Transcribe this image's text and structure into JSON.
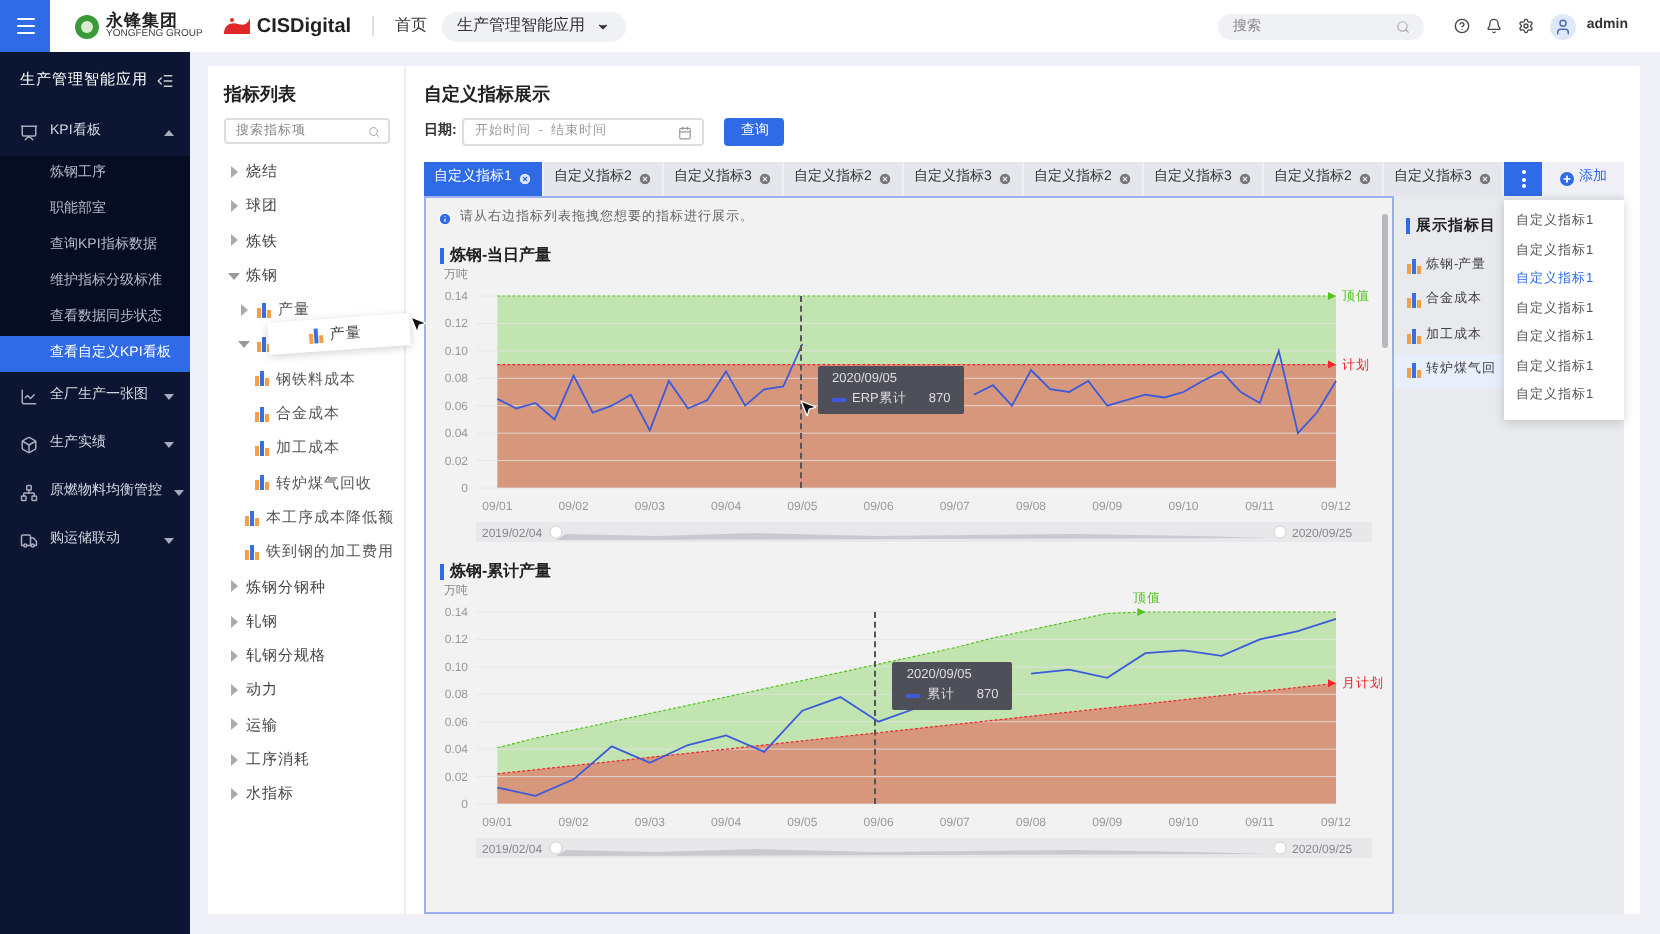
{
  "topbar": {
    "logos": [
      {
        "kind": "yongfeng",
        "name": "永锋集团",
        "subtitle": "YONGFENG GROUP"
      },
      {
        "kind": "cis",
        "name": "CISDigital"
      }
    ],
    "nav": [
      {
        "kind": "link",
        "label": "首页"
      },
      {
        "kind": "dropdown",
        "label": "生产管理智能应用"
      }
    ],
    "search": {
      "placeholder": "搜索"
    },
    "user": "admin"
  },
  "sidebar": {
    "title": "生产管理智能应用",
    "items": [
      {
        "label": "KPI看板",
        "expanded": true,
        "children": [
          {
            "label": "炼钢工序",
            "selected": false
          },
          {
            "label": "职能部室",
            "selected": false
          },
          {
            "label": "查询KPI指标数据",
            "selected": false
          },
          {
            "label": "维护指标分级标准",
            "selected": false
          },
          {
            "label": "查看数据同步状态",
            "selected": false
          },
          {
            "label": "查看自定义KPI看板",
            "selected": true
          }
        ]
      },
      {
        "label": "全厂生产一张图",
        "expanded": false
      },
      {
        "label": "生产实绩",
        "expanded": false
      },
      {
        "label": "原燃物料均衡管控",
        "expanded": false
      },
      {
        "label": "购运储联动",
        "expanded": false
      }
    ]
  },
  "indicator_list": {
    "title": "指标列表",
    "search": {
      "placeholder": "搜索指标项"
    },
    "tree": [
      {
        "kind": "group",
        "label": "烧结",
        "expanded": false
      },
      {
        "kind": "group",
        "label": "球团",
        "expanded": false
      },
      {
        "kind": "group",
        "label": "炼铁",
        "expanded": false
      },
      {
        "kind": "group",
        "label": "炼钢",
        "expanded": true,
        "children": [
          {
            "kind": "metric",
            "label": "产量",
            "expanded": false
          },
          {
            "kind": "metric",
            "expanded": true,
            "children": [
              {
                "kind": "metric",
                "label": "钢铁料成本"
              },
              {
                "kind": "metric",
                "label": "合金成本"
              },
              {
                "kind": "metric",
                "label": "加工成本"
              },
              {
                "kind": "metric",
                "label": "转炉煤气回收"
              }
            ]
          },
          {
            "kind": "metric",
            "label": "本工序成本降低额"
          },
          {
            "kind": "metric",
            "label": "铁到钢的加工费用"
          }
        ]
      },
      {
        "kind": "group",
        "label": "炼钢分钢种",
        "expanded": false
      },
      {
        "kind": "group",
        "label": "轧钢",
        "expanded": false
      },
      {
        "kind": "group",
        "label": "轧钢分规格",
        "expanded": false
      },
      {
        "kind": "group",
        "label": "动力",
        "expanded": false
      },
      {
        "kind": "group",
        "label": "运输",
        "expanded": false
      },
      {
        "kind": "group",
        "label": "工序消耗",
        "expanded": false
      },
      {
        "kind": "group",
        "label": "水指标",
        "expanded": false
      }
    ],
    "drag_preview": {
      "label": "产量"
    }
  },
  "display": {
    "title": "自定义指标展示",
    "date_label": "日期:",
    "start_placeholder": "开始时间",
    "separator": "-",
    "end_placeholder": "结束时间",
    "query_button": "查询",
    "tabs": [
      {
        "label": "自定义指标1",
        "selected": true
      },
      {
        "label": "自定义指标2",
        "selected": false
      },
      {
        "label": "自定义指标3",
        "selected": false
      },
      {
        "label": "自定义指标2",
        "selected": false
      },
      {
        "label": "自定义指标3",
        "selected": false
      },
      {
        "label": "自定义指标2",
        "selected": false
      },
      {
        "label": "自定义指标3",
        "selected": false
      },
      {
        "label": "自定义指标2",
        "selected": false
      },
      {
        "label": "自定义指标3",
        "selected": false
      }
    ],
    "more_menu": [
      {
        "label": "自定义指标1",
        "selected": false
      },
      {
        "label": "自定义指标1",
        "selected": false
      },
      {
        "label": "自定义指标1",
        "selected": true
      },
      {
        "label": "自定义指标1",
        "selected": false
      },
      {
        "label": "自定义指标1",
        "selected": false
      },
      {
        "label": "自定义指标1",
        "selected": false
      },
      {
        "label": "自定义指标1",
        "selected": false
      }
    ],
    "add_button": "添加",
    "notice": "请从右边指标列表拖拽您想要的指标进行展示。",
    "charts": [
      {
        "kind": "daily",
        "title": "炼钢-当日产量",
        "unit": "万吨",
        "tooltip": {
          "date": "2020/09/05",
          "value": "870"
        },
        "range": {
          "start": "2019/02/04",
          "end": "2020/09/25"
        },
        "chart_data": {
          "type": "line",
          "grid": true,
          "ylim": [
            0,
            0.14
          ],
          "yticks": [
            {
              "value": 0,
              "label": "0"
            },
            {
              "value": 0.02,
              "label": "0.02"
            },
            {
              "value": 0.04,
              "label": "0.04"
            },
            {
              "value": 0.06,
              "label": "0.06"
            },
            {
              "value": 0.08,
              "label": "0.08"
            },
            {
              "value": 0.1,
              "label": "0.10"
            },
            {
              "value": 0.12,
              "label": "0.12"
            },
            {
              "value": 0.14,
              "label": "0.14"
            }
          ],
          "categories": [
            "09/01",
            null,
            null,
            null,
            "09/02",
            null,
            null,
            null,
            "09/03",
            null,
            null,
            null,
            "09/04",
            null,
            null,
            null,
            "09/05",
            null,
            null,
            null,
            "09/06",
            null,
            null,
            null,
            "09/07",
            null,
            null,
            null,
            "09/08",
            null,
            null,
            null,
            "09/09",
            null,
            null,
            null,
            "09/10",
            null,
            null,
            null,
            "09/11",
            null,
            null,
            null,
            "09/12"
          ],
          "series": [
            {
              "name": "ERP累计",
              "color": "#3b5bdb",
              "values": [
                0.065,
                0.058,
                0.062,
                0.05,
                0.082,
                0.055,
                0.06,
                0.068,
                0.042,
                0.078,
                0.058,
                0.064,
                0.085,
                0.06,
                0.072,
                0.074,
                0.105,
                null,
                null,
                null,
                null,
                null,
                null,
                null,
                null,
                0.068,
                0.075,
                0.06,
                0.086,
                0.072,
                0.07,
                0.078,
                0.06,
                0.064,
                0.068,
                0.066,
                0.07,
                0.078,
                0.085,
                0.07,
                0.062,
                0.1,
                0.04,
                0.055,
                0.078
              ]
            },
            {
              "name": "顶值",
              "color": "#52c41a",
              "line_style": "dashed",
              "type": "area",
              "values": [
                0.14,
                0.14,
                0.14,
                0.14,
                0.14,
                0.14,
                0.14,
                0.14,
                0.14,
                0.14,
                0.14,
                0.14,
                0.14,
                0.14,
                0.14,
                0.14,
                0.14,
                0.14,
                0.14,
                0.14,
                0.14,
                0.14,
                0.14,
                0.14,
                0.14,
                0.14,
                0.14,
                0.14,
                0.14,
                0.14,
                0.14,
                0.14,
                0.14,
                0.14,
                0.14,
                0.14,
                0.14,
                0.14,
                0.14,
                0.14,
                0.14,
                0.14,
                0.14,
                0.14,
                0.14
              ]
            },
            {
              "name": "计划",
              "color": "#f5222d",
              "line_style": "dashed",
              "type": "area",
              "values": [
                0.09,
                0.09,
                0.09,
                0.09,
                0.09,
                0.09,
                0.09,
                0.09,
                0.09,
                0.09,
                0.09,
                0.09,
                0.09,
                0.09,
                0.09,
                0.09,
                0.09,
                0.09,
                0.09,
                0.09,
                0.09,
                0.09,
                0.09,
                0.09,
                0.09,
                0.09,
                0.09,
                0.09,
                0.09,
                0.09,
                0.09,
                0.09,
                0.09,
                0.09,
                0.09,
                0.09,
                0.09,
                0.09,
                0.09,
                0.09,
                0.09,
                0.09,
                0.09,
                0.09,
                0.09
              ]
            }
          ]
        }
      },
      {
        "kind": "cumulative",
        "title": "炼钢-累计产量",
        "unit": "万吨",
        "tooltip": {
          "date": "2020/09/05",
          "value": "870"
        },
        "range": {
          "start": "2019/02/04",
          "end": "2020/09/25"
        },
        "chart_data": {
          "type": "line",
          "grid": true,
          "ylim": [
            0,
            0.14
          ],
          "yticks": [
            {
              "value": 0,
              "label": "0"
            },
            {
              "value": 0.02,
              "label": "0.02"
            },
            {
              "value": 0.04,
              "label": "0.04"
            },
            {
              "value": 0.06,
              "label": "0.06"
            },
            {
              "value": 0.08,
              "label": "0.08"
            },
            {
              "value": 0.1,
              "label": "0.10"
            },
            {
              "value": 0.12,
              "label": "0.12"
            },
            {
              "value": 0.14,
              "label": "0.14"
            }
          ],
          "categories": [
            "09/01",
            null,
            "09/02",
            null,
            "09/03",
            null,
            "09/04",
            null,
            "09/05",
            null,
            "09/06",
            null,
            "09/07",
            null,
            "09/08",
            null,
            "09/09",
            null,
            "09/10",
            null,
            "09/11",
            null,
            "09/12"
          ],
          "series": [
            {
              "name": "累计",
              "color": "#3b5bdb",
              "values": [
                0.012,
                0.006,
                0.018,
                0.042,
                0.03,
                0.043,
                0.05,
                0.038,
                0.068,
                0.078,
                0.06,
                0.07,
                null,
                null,
                0.095,
                0.098,
                0.092,
                0.11,
                0.112,
                0.108,
                0.12,
                0.126,
                0.135
              ]
            },
            {
              "name": "顶值",
              "color": "#52c41a",
              "line_style": "dashed",
              "type": "area",
              "values": [
                0.041,
                0.048,
                0.054,
                0.06,
                0.066,
                0.072,
                0.078,
                0.084,
                0.09,
                0.096,
                0.102,
                0.108,
                0.114,
                0.121,
                0.127,
                0.133,
                0.139,
                0.14,
                0.14,
                0.14,
                0.14,
                0.14,
                0.14
              ]
            },
            {
              "name": "月计划",
              "color": "#f5222d",
              "line_style": "dashed",
              "type": "area",
              "values": [
                0.022,
                0.025,
                0.028,
                0.031,
                0.034,
                0.037,
                0.04,
                0.043,
                0.046,
                0.049,
                0.052,
                0.055,
                0.058,
                0.061,
                0.064,
                0.067,
                0.07,
                0.073,
                0.076,
                0.079,
                0.082,
                0.085,
                0.088
              ]
            }
          ]
        }
      }
    ],
    "panel": {
      "title": "展示指标目",
      "items": [
        {
          "label": "炼钢-产量",
          "selected": false
        },
        {
          "label": "合金成本",
          "selected": false
        },
        {
          "label": "加工成本",
          "selected": false
        },
        {
          "label": "转炉煤气回",
          "selected": true
        }
      ]
    }
  }
}
